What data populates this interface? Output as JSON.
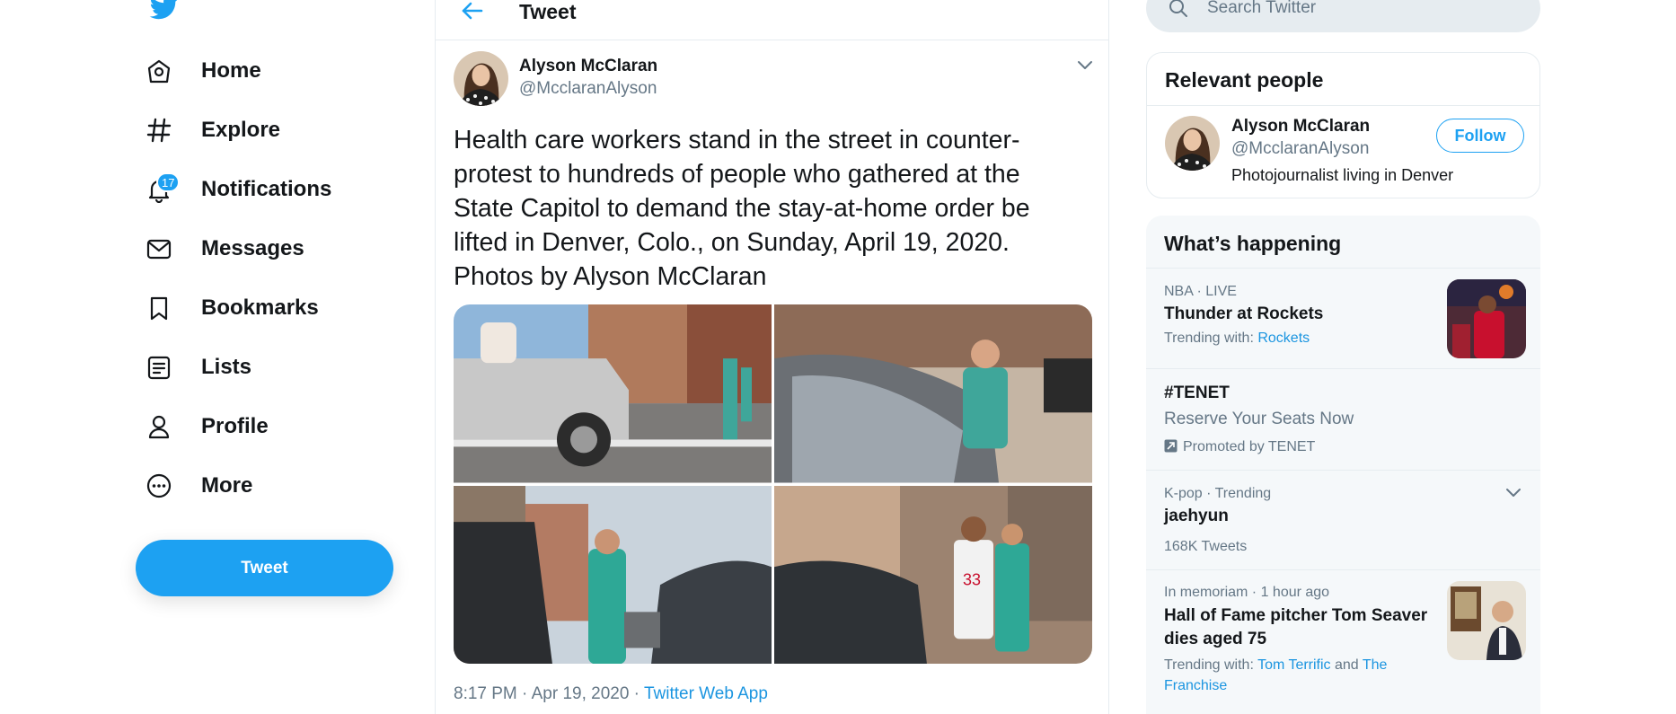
{
  "nav": {
    "items": [
      {
        "label": "Home"
      },
      {
        "label": "Explore"
      },
      {
        "label": "Notifications",
        "badge": "17"
      },
      {
        "label": "Messages"
      },
      {
        "label": "Bookmarks"
      },
      {
        "label": "Lists"
      },
      {
        "label": "Profile"
      },
      {
        "label": "More"
      }
    ],
    "tweet_button": "Tweet"
  },
  "header": {
    "title": "Tweet"
  },
  "tweet": {
    "author_name": "Alyson McClaran",
    "author_handle": "@McclaranAlyson",
    "text": "Health care workers stand in the street in counter-protest to hundreds of people who gathered at the State Capitol to demand the stay-at-home order be lifted in Denver, Colo., on Sunday, April 19, 2020. Photos by Alyson McClaran",
    "timestamp": "8:17 PM · Apr 19, 2020 · ",
    "source_app": "Twitter Web App"
  },
  "search": {
    "placeholder": "Search Twitter"
  },
  "relevant_people": {
    "title": "Relevant people",
    "person": {
      "name": "Alyson McClaran",
      "handle": "@McclaranAlyson",
      "bio": "Photojournalist living in Denver",
      "follow_label": "Follow"
    }
  },
  "trends": {
    "title": "What’s happening",
    "items": [
      {
        "meta": "NBA · LIVE",
        "title": "Thunder at Rockets",
        "sub_prefix": "Trending with: ",
        "link1": "Rockets"
      },
      {
        "title": "#TENET",
        "desc": "Reserve Your Seats Now",
        "promoted": "Promoted by TENET"
      },
      {
        "meta": "K-pop · Trending",
        "title": "jaehyun",
        "count": "168K Tweets"
      },
      {
        "meta": "In memoriam · 1 hour ago",
        "title_line1": "Hall of Fame pitcher Tom Seaver",
        "title_line2": "dies aged 75",
        "sub_prefix": "Trending with: ",
        "link1": "Tom Terrific",
        "joiner": " and ",
        "link2_line1": "The",
        "link2_line2": "Franchise"
      }
    ]
  },
  "colors": {
    "accent": "#1da1f2",
    "link": "#1b95e0",
    "text": "#14171a",
    "muted": "#657786",
    "border": "#e6ecf0"
  }
}
